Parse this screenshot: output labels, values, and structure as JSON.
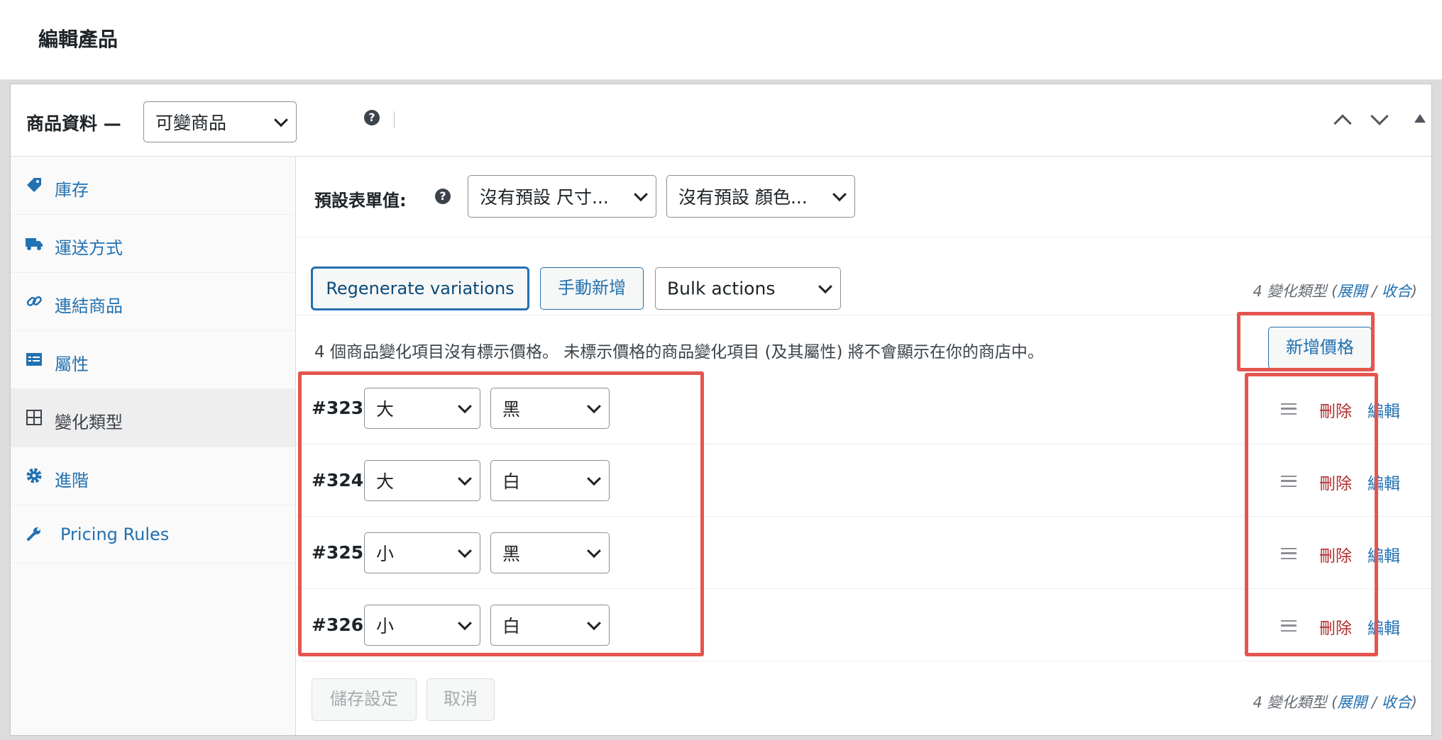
{
  "page": {
    "title": "編輯產品"
  },
  "product_data": {
    "label": "商品資料 —",
    "type_select": "可變商品",
    "help_icon": "question-icon"
  },
  "sidebar": {
    "items": [
      {
        "label": "庫存",
        "icon": "tag-icon"
      },
      {
        "label": "運送方式",
        "icon": "truck-icon"
      },
      {
        "label": "連結商品",
        "icon": "link-icon"
      },
      {
        "label": "屬性",
        "icon": "list-icon"
      },
      {
        "label": "變化類型",
        "icon": "grid-icon"
      },
      {
        "label": "進階",
        "icon": "gear-icon"
      },
      {
        "label": "Pricing Rules",
        "icon": "wrench-icon"
      }
    ]
  },
  "defaults": {
    "label": "預設表單值:",
    "size_select": "沒有預設 尺寸...",
    "color_select": "沒有預設 顏色..."
  },
  "toolbar": {
    "regenerate": "Regenerate variations",
    "manual_add": "手動新增",
    "bulk_actions": "Bulk actions",
    "count_prefix": "4 變化類型 (",
    "expand": "展開",
    "slash": " / ",
    "collapse": "收合",
    "count_suffix": ")"
  },
  "notice": {
    "text": "4 個商品變化項目沒有標示價格。 未標示價格的商品變化項目 (及其屬性) 將不會顯示在你的商店中。",
    "add_price": "新增價格"
  },
  "variations": [
    {
      "id": "#323",
      "size": "大",
      "color": "黑",
      "delete": "刪除",
      "edit": "編輯"
    },
    {
      "id": "#324",
      "size": "大",
      "color": "白",
      "delete": "刪除",
      "edit": "編輯"
    },
    {
      "id": "#325",
      "size": "小",
      "color": "黑",
      "delete": "刪除",
      "edit": "編輯"
    },
    {
      "id": "#326",
      "size": "小",
      "color": "白",
      "delete": "刪除",
      "edit": "編輯"
    }
  ],
  "footer": {
    "save": "儲存設定",
    "cancel": "取消"
  },
  "colors": {
    "accent": "#2271b1",
    "delete": "#b32d2e",
    "highlight": "#e5554f"
  }
}
